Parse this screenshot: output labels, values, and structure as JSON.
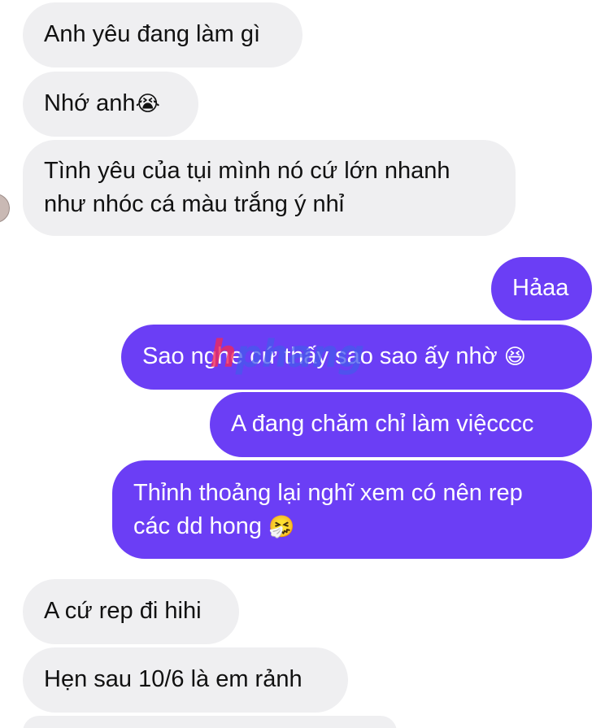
{
  "messages": [
    {
      "side": "received",
      "text": "Anh yêu đang làm gì",
      "emoji": ""
    },
    {
      "side": "received",
      "text": "Nhớ anh",
      "emoji": "😭"
    },
    {
      "side": "received",
      "lines": [
        "Tình yêu của tụi mình nó cứ lớn nhanh",
        "như nhóc cá màu trắng ý nhỉ"
      ]
    },
    {
      "side": "sent",
      "text": "Hảaa",
      "emoji": ""
    },
    {
      "side": "sent",
      "text": "Sao nghe cứ thấy sao sao ấy nhờ ",
      "emoji": "😆"
    },
    {
      "side": "sent",
      "text": "A đang chăm chỉ làm việcccc",
      "emoji": ""
    },
    {
      "side": "sent",
      "lines": [
        "Thỉnh thoảng lại nghĩ xem có nên rep",
        "các dd hong "
      ],
      "emoji": "🤧"
    },
    {
      "side": "received",
      "text": "A cứ rep đi hihi",
      "emoji": ""
    },
    {
      "side": "received",
      "text": "Hẹn sau 10/6 là em rảnh",
      "emoji": ""
    }
  ],
  "watermark": {
    "first": "h",
    "rest": "phang"
  },
  "colors": {
    "received_bubble": "#efeff1",
    "sent_bubble": "#6b3ef5",
    "sent_text": "#ffffff",
    "received_text": "#111111"
  }
}
